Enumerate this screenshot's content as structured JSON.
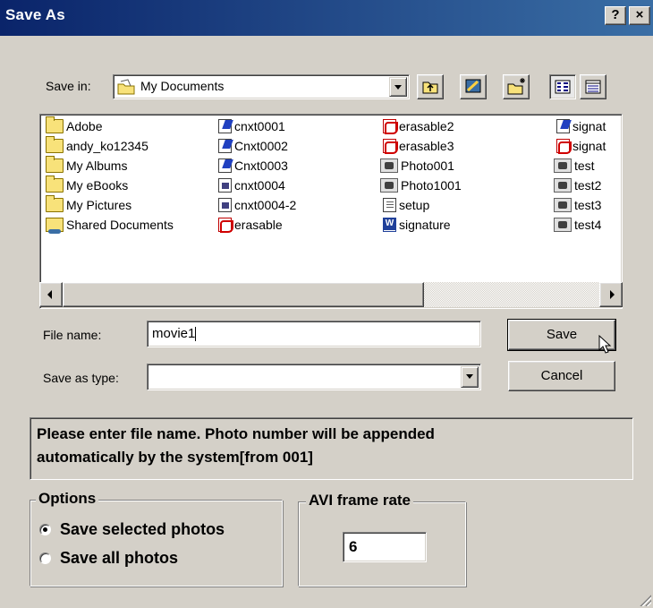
{
  "window": {
    "title": "Save As",
    "help_label": "?",
    "close_label": "×"
  },
  "save_in": {
    "label": "Save in:",
    "value": "My Documents"
  },
  "files": {
    "col1": [
      "Adobe",
      "andy_ko12345",
      "My Albums",
      "My eBooks",
      "My Pictures",
      "Shared Documents"
    ],
    "col2": [
      "cnxt0001",
      "Cnxt0002",
      "Cnxt0003",
      "cnxt0004",
      "cnxt0004-2",
      "erasable"
    ],
    "col3": [
      "erasable2",
      "erasable3",
      "Photo001",
      "Photo1001",
      "setup",
      "signature"
    ],
    "col4": [
      "signat",
      "signat",
      "test",
      "test2",
      "test3",
      "test4"
    ]
  },
  "file_name": {
    "label": "File name:",
    "value": "movie1"
  },
  "save_as_type": {
    "label": "Save as type:",
    "value": ""
  },
  "buttons": {
    "save": "Save",
    "cancel": "Cancel"
  },
  "message": {
    "line1": "Please enter file name. Photo number will be appended",
    "line2": "automatically by the system[from 001]"
  },
  "options": {
    "legend": "Options",
    "choices": [
      "Save selected photos",
      "Save all photos"
    ],
    "selected": "Save selected photos"
  },
  "frame_rate": {
    "legend": "AVI frame rate",
    "value": "6"
  }
}
